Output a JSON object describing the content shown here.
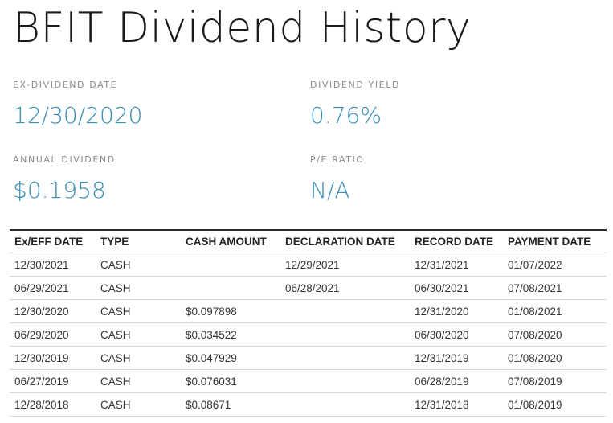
{
  "page": {
    "title": "BFIT Dividend History"
  },
  "colors": {
    "accent": "#3a8fb7",
    "label": "#8a8a8a",
    "text": "#222222",
    "rule": "#d8d8d8"
  },
  "stats": {
    "ex_dividend_date": {
      "label": "EX-DIVIDEND DATE",
      "value": "12/30/2020"
    },
    "dividend_yield": {
      "label": "DIVIDEND YIELD",
      "value": "0.76%"
    },
    "annual_dividend": {
      "label": "ANNUAL DIVIDEND",
      "value": "$0.1958"
    },
    "pe_ratio": {
      "label": "P/E RATIO",
      "value": "N/A"
    }
  },
  "table": {
    "headers": [
      "Ex/EFF DATE",
      "TYPE",
      "CASH AMOUNT",
      "DECLARATION DATE",
      "RECORD DATE",
      "PAYMENT DATE"
    ],
    "rows": [
      [
        "12/30/2021",
        "CASH",
        "",
        "12/29/2021",
        "12/31/2021",
        "01/07/2022"
      ],
      [
        "06/29/2021",
        "CASH",
        "",
        "06/28/2021",
        "06/30/2021",
        "07/08/2021"
      ],
      [
        "12/30/2020",
        "CASH",
        "$0.097898",
        "",
        "12/31/2020",
        "01/08/2021"
      ],
      [
        "06/29/2020",
        "CASH",
        "$0.034522",
        "",
        "06/30/2020",
        "07/08/2020"
      ],
      [
        "12/30/2019",
        "CASH",
        "$0.047929",
        "",
        "12/31/2019",
        "01/08/2020"
      ],
      [
        "06/27/2019",
        "CASH",
        "$0.076031",
        "",
        "06/28/2019",
        "07/08/2019"
      ],
      [
        "12/28/2018",
        "CASH",
        "$0.08671",
        "",
        "12/31/2018",
        "01/08/2019"
      ]
    ]
  }
}
